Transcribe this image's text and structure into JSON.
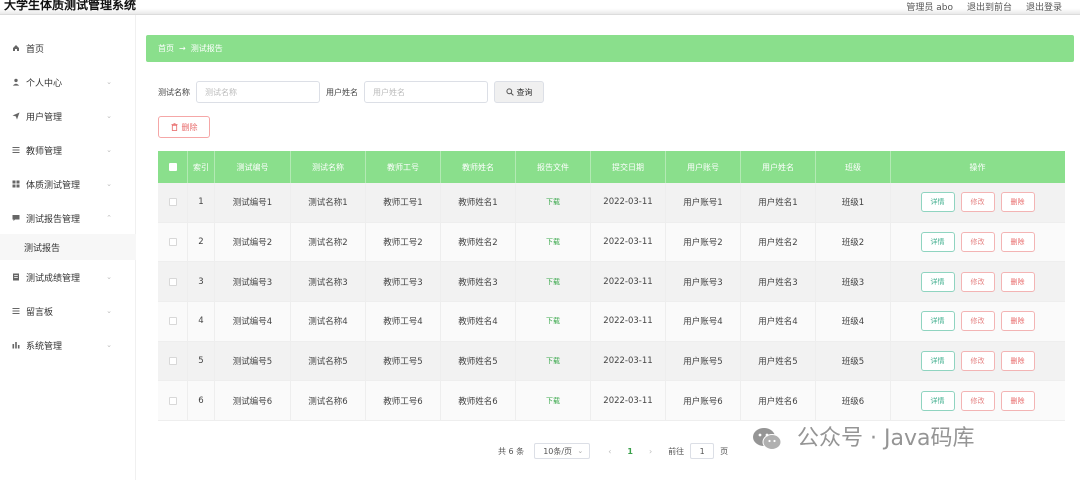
{
  "header": {
    "title": "大学生体质测试管理系统",
    "admin": "管理员 abo",
    "back_front": "退出到前台",
    "logout": "退出登录"
  },
  "sidebar": {
    "items": [
      {
        "label": "首页",
        "icon": "home-icon"
      },
      {
        "label": "个人中心",
        "icon": "user-icon"
      },
      {
        "label": "用户管理",
        "icon": "send-icon"
      },
      {
        "label": "教师管理",
        "icon": "list-icon"
      },
      {
        "label": "体质测试管理",
        "icon": "grid-icon"
      },
      {
        "label": "测试报告管理",
        "icon": "chat-icon"
      },
      {
        "label": "测试成绩管理",
        "icon": "doc-icon"
      },
      {
        "label": "留言板",
        "icon": "list-icon"
      },
      {
        "label": "系统管理",
        "icon": "bars-icon"
      }
    ],
    "sub_item": "测试报告"
  },
  "breadcrumb": {
    "home": "首页",
    "sep": "→",
    "current": "测试报告"
  },
  "search": {
    "name_label": "测试名称",
    "name_placeholder": "测试名称",
    "user_label": "用户姓名",
    "user_placeholder": "用户姓名",
    "query_label": "查询"
  },
  "toolbar": {
    "delete_label": "删除"
  },
  "table": {
    "headers": [
      "索引",
      "测试编号",
      "测试名称",
      "教师工号",
      "教师姓名",
      "报告文件",
      "提交日期",
      "用户账号",
      "用户姓名",
      "班级",
      "操作"
    ],
    "rows": [
      {
        "idx": "1",
        "code": "测试编号1",
        "name": "测试名称1",
        "tid": "教师工号1",
        "tname": "教师姓名1",
        "file": "下载",
        "date": "2022-03-11",
        "uacc": "用户账号1",
        "uname": "用户姓名1",
        "cls": "班级1"
      },
      {
        "idx": "2",
        "code": "测试编号2",
        "name": "测试名称2",
        "tid": "教师工号2",
        "tname": "教师姓名2",
        "file": "下载",
        "date": "2022-03-11",
        "uacc": "用户账号2",
        "uname": "用户姓名2",
        "cls": "班级2"
      },
      {
        "idx": "3",
        "code": "测试编号3",
        "name": "测试名称3",
        "tid": "教师工号3",
        "tname": "教师姓名3",
        "file": "下载",
        "date": "2022-03-11",
        "uacc": "用户账号3",
        "uname": "用户姓名3",
        "cls": "班级3"
      },
      {
        "idx": "4",
        "code": "测试编号4",
        "name": "测试名称4",
        "tid": "教师工号4",
        "tname": "教师姓名4",
        "file": "下载",
        "date": "2022-03-11",
        "uacc": "用户账号4",
        "uname": "用户姓名4",
        "cls": "班级4"
      },
      {
        "idx": "5",
        "code": "测试编号5",
        "name": "测试名称5",
        "tid": "教师工号5",
        "tname": "教师姓名5",
        "file": "下载",
        "date": "2022-03-11",
        "uacc": "用户账号5",
        "uname": "用户姓名5",
        "cls": "班级5"
      },
      {
        "idx": "6",
        "code": "测试编号6",
        "name": "测试名称6",
        "tid": "教师工号6",
        "tname": "教师姓名6",
        "file": "下载",
        "date": "2022-03-11",
        "uacc": "用户账号6",
        "uname": "用户姓名6",
        "cls": "班级6"
      }
    ],
    "actions": {
      "detail": "详情",
      "edit": "修改",
      "delete": "删除"
    }
  },
  "pagination": {
    "total": "共 6 条",
    "page_size": "10条/页",
    "current_page": "1",
    "goto_label": "前往",
    "goto_value": "1",
    "page_suffix": "页"
  },
  "watermark": {
    "text": "公众号 · Java码库"
  },
  "colors": {
    "accent_green": "#8adf8c",
    "danger": "#e86a6a",
    "link_green": "#39a84b"
  }
}
